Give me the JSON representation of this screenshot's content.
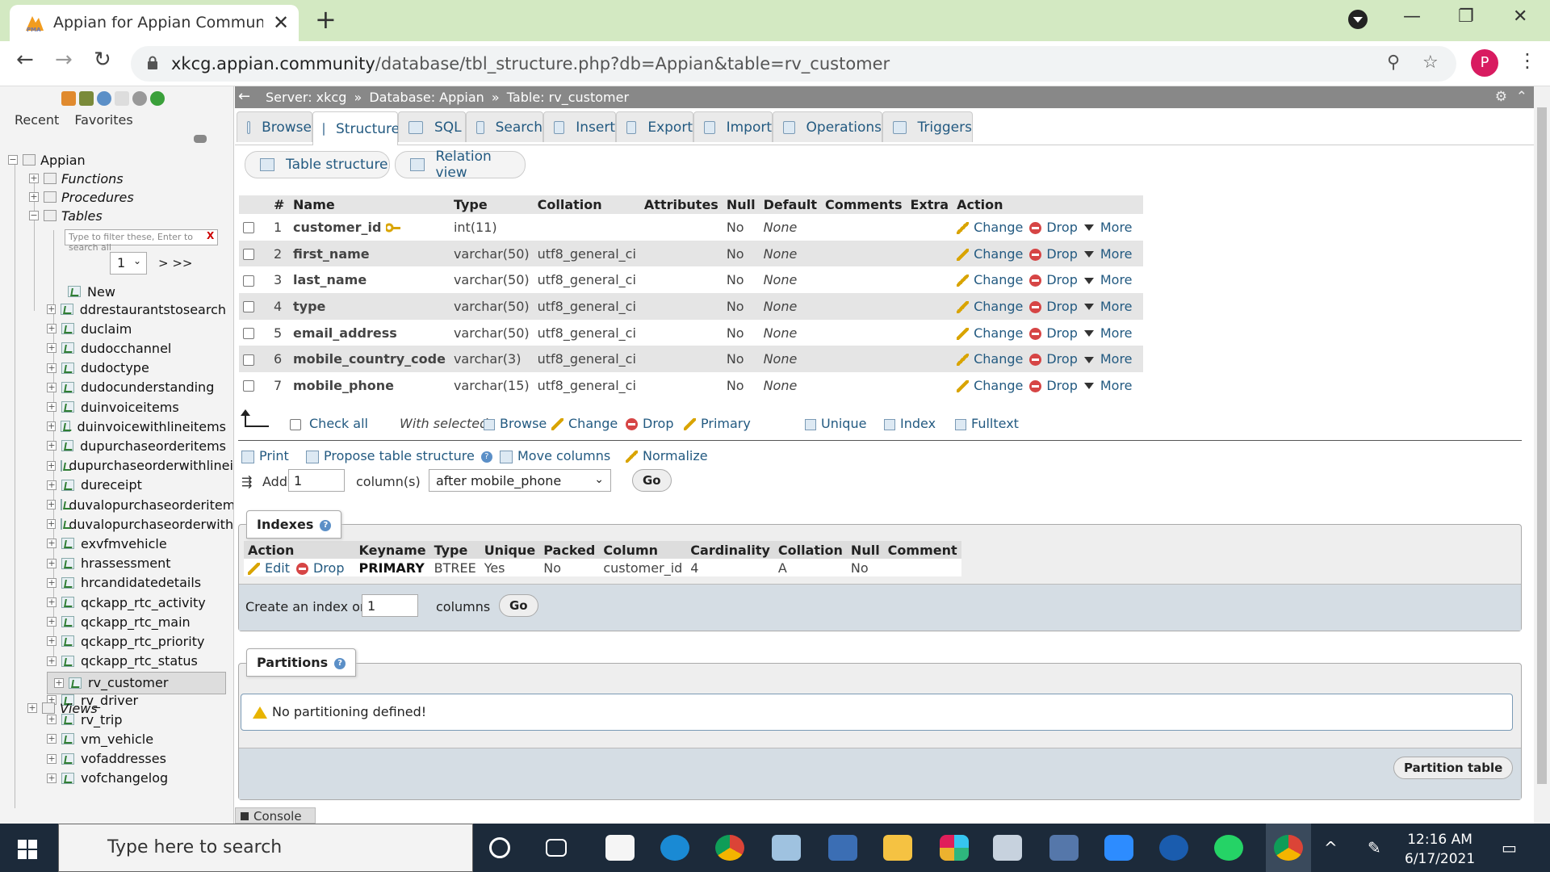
{
  "browser": {
    "tab_title": "Appian for Appian Community E",
    "url_host": "xkcg.appian.community",
    "url_path": "/database/tbl_structure.php?db=Appian&table=rv_customer",
    "profile_letter": "P",
    "new_tab": "+",
    "tab_close": "✕"
  },
  "nav": {
    "links": [
      "Recent",
      "Favorites"
    ],
    "db_name": "Appian",
    "groups": [
      "Functions",
      "Procedures",
      "Tables",
      "Views"
    ],
    "filter_placeholder": "Type to filter these, Enter to search all",
    "filter_clear": "X",
    "page_select": "1",
    "page_next": "> >>",
    "new_label": "New",
    "tables": [
      "ddrestaurantstosearch",
      "duclaim",
      "dudocchannel",
      "dudoctype",
      "dudocunderstanding",
      "duinvoiceitems",
      "duinvoicewithlineitems",
      "dupurchaseorderitems",
      "dupurchaseorderwithlineit",
      "dureceipt",
      "duvalopurchaseorderitems",
      "duvalopurchaseorderwithl",
      "exvfmvehicle",
      "hrassessment",
      "hrcandidatedetails",
      "qckapp_rtc_activity",
      "qckapp_rtc_main",
      "qckapp_rtc_priority",
      "qckapp_rtc_status",
      "rv_customer",
      "rv_driver",
      "rv_trip",
      "vm_vehicle",
      "vofaddresses",
      "vofchangelog"
    ],
    "selected_table": "rv_customer"
  },
  "breadcrumb": {
    "server": "Server: xkcg",
    "database": "Database: Appian",
    "table": "Table: rv_customer",
    "sep": "»"
  },
  "menu_tabs": [
    "Browse",
    "Structure",
    "SQL",
    "Search",
    "Insert",
    "Export",
    "Import",
    "Operations",
    "Triggers"
  ],
  "active_tab": "Structure",
  "sub_tabs": [
    "Table structure",
    "Relation view"
  ],
  "structure": {
    "headers": [
      "#",
      "Name",
      "Type",
      "Collation",
      "Attributes",
      "Null",
      "Default",
      "Comments",
      "Extra",
      "Action"
    ],
    "rows": [
      {
        "num": "1",
        "name": "customer_id",
        "type": "int(11)",
        "collation": "",
        "null": "No",
        "default": "None",
        "primary": true
      },
      {
        "num": "2",
        "name": "first_name",
        "type": "varchar(50)",
        "collation": "utf8_general_ci",
        "null": "No",
        "default": "None"
      },
      {
        "num": "3",
        "name": "last_name",
        "type": "varchar(50)",
        "collation": "utf8_general_ci",
        "null": "No",
        "default": "None"
      },
      {
        "num": "4",
        "name": "type",
        "type": "varchar(50)",
        "collation": "utf8_general_ci",
        "null": "No",
        "default": "None"
      },
      {
        "num": "5",
        "name": "email_address",
        "type": "varchar(50)",
        "collation": "utf8_general_ci",
        "null": "No",
        "default": "None"
      },
      {
        "num": "6",
        "name": "mobile_country_code",
        "type": "varchar(3)",
        "collation": "utf8_general_ci",
        "null": "No",
        "default": "None"
      },
      {
        "num": "7",
        "name": "mobile_phone",
        "type": "varchar(15)",
        "collation": "utf8_general_ci",
        "null": "No",
        "default": "None"
      }
    ],
    "action_change": "Change",
    "action_drop": "Drop",
    "action_more": "More"
  },
  "with_selected": {
    "check_all": "Check all",
    "label": "With selected:",
    "items": [
      "Browse",
      "Change",
      "Drop",
      "Primary",
      "Unique",
      "Index",
      "Fulltext"
    ]
  },
  "tools": {
    "print": "Print",
    "propose": "Propose table structure",
    "move": "Move columns",
    "normalize": "Normalize",
    "add": "Add",
    "add_value": "1",
    "columns_label": "column(s)",
    "position_select": "after mobile_phone",
    "go": "Go"
  },
  "indexes": {
    "legend": "Indexes",
    "headers": [
      "Action",
      "Keyname",
      "Type",
      "Unique",
      "Packed",
      "Column",
      "Cardinality",
      "Collation",
      "Null",
      "Comment"
    ],
    "row": {
      "edit": "Edit",
      "drop": "Drop",
      "keyname": "PRIMARY",
      "type": "BTREE",
      "unique": "Yes",
      "packed": "No",
      "column": "customer_id",
      "cardinality": "4",
      "collation": "A",
      "null": "No",
      "comment": ""
    },
    "create_label": "Create an index on",
    "create_value": "1",
    "columns_label": "columns",
    "go": "Go"
  },
  "partitions": {
    "legend": "Partitions",
    "notice": "No partitioning defined!",
    "button": "Partition table"
  },
  "console": "Console",
  "taskbar": {
    "search_placeholder": "Type here to search",
    "time": "12:16 AM",
    "date": "6/17/2021"
  }
}
